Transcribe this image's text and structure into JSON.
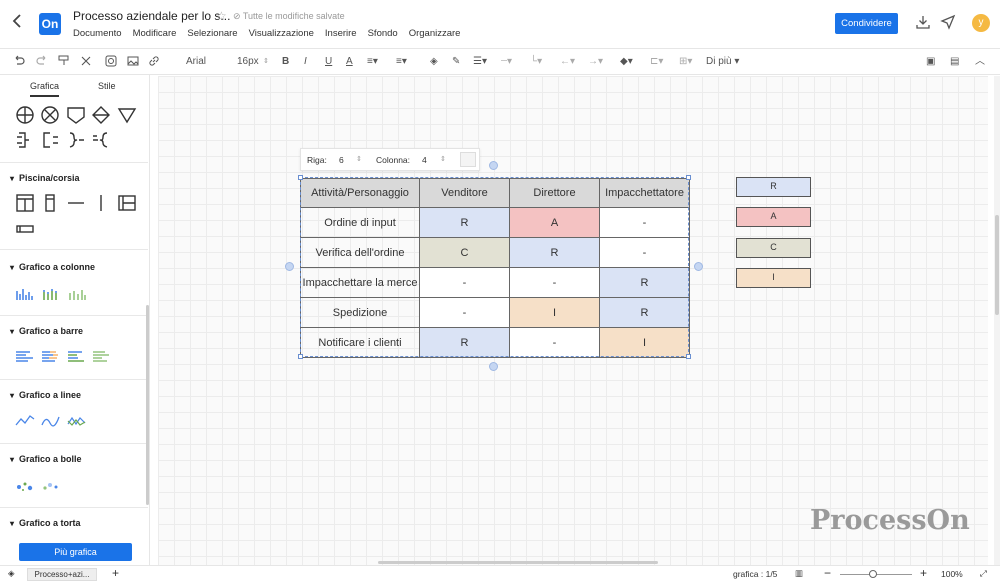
{
  "header": {
    "back_icon": "chevron-left-icon",
    "logo": "On",
    "title": "Processo aziendale per lo s...",
    "saved_status": "Tutte le modifiche salvate",
    "menu": [
      "Documento",
      "Modificare",
      "Selezionare",
      "Visualizzazione",
      "Inserire",
      "Sfondo",
      "Organizzare"
    ],
    "share_label": "Condividere",
    "avatar_letter": "y"
  },
  "toolbar": {
    "font_family": "Arial",
    "font_size": "16px",
    "more_label": "Di più"
  },
  "sidebar": {
    "tabs": [
      "Grafica",
      "Stile"
    ],
    "sections": [
      {
        "title": "Piscina/corsia"
      },
      {
        "title": "Grafico a colonne"
      },
      {
        "title": "Grafico a barre"
      },
      {
        "title": "Grafico a linee"
      },
      {
        "title": "Grafico a bolle"
      },
      {
        "title": "Grafico a torta"
      }
    ],
    "more_button": "Più grafica"
  },
  "table_popup": {
    "row_label": "Riga:",
    "row_value": "6",
    "col_label": "Colonna:",
    "col_value": "4"
  },
  "raci_table": {
    "headers": [
      "Attività/Personaggio",
      "Venditore",
      "Direttore",
      "Impacchettatore"
    ],
    "rows": [
      [
        "Ordine di input",
        "R",
        "A",
        "-"
      ],
      [
        "Verifica dell'ordine",
        "C",
        "R",
        "-"
      ],
      [
        "Impacchettare la merce",
        "-",
        "-",
        "R"
      ],
      [
        "Spedizione",
        "-",
        "I",
        "R"
      ],
      [
        "Notificare i clienti",
        "R",
        "-",
        "I"
      ]
    ]
  },
  "legend": [
    "R",
    "A",
    "C",
    "I"
  ],
  "colors": {
    "R": "#dae3f5",
    "A": "#f4c2c2",
    "C": "#e2e1d3",
    "I": "#f6e0c8",
    "accent": "#1a73e8"
  },
  "watermark": "ProcessOn",
  "statusbar": {
    "page_tab": "Processo+azi...",
    "shape_count": "grafica : 1/5",
    "zoom": "100%"
  }
}
